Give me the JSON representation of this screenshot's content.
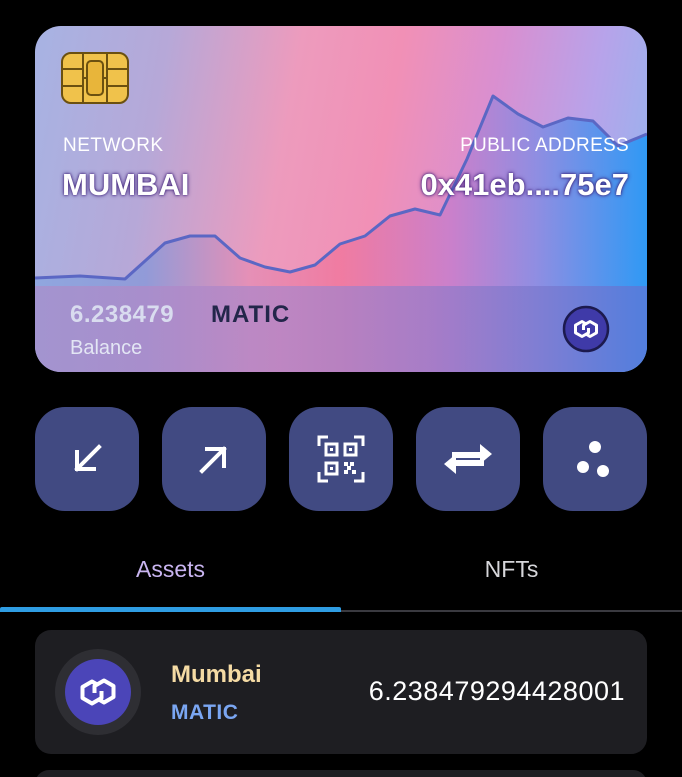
{
  "card": {
    "network_label": "NETWORK",
    "network_name": "MUMBAI",
    "address_label": "PUBLIC ADDRESS",
    "address_value": "0x41eb....75e7",
    "balance_amount": "6.238479",
    "balance_symbol": "MATIC",
    "balance_label": "Balance",
    "chip_icon": "sim-chip-icon",
    "token_icon": "polygon-logo-icon"
  },
  "actions": [
    {
      "name": "receive-button",
      "icon": "arrow-down-left-icon"
    },
    {
      "name": "send-button",
      "icon": "arrow-up-right-icon"
    },
    {
      "name": "scan-qr-button",
      "icon": "qr-code-icon"
    },
    {
      "name": "swap-button",
      "icon": "swap-arrows-icon"
    },
    {
      "name": "more-button",
      "icon": "three-dots-icon"
    }
  ],
  "tabs": [
    {
      "label": "Assets",
      "active": true
    },
    {
      "label": "NFTs",
      "active": false
    }
  ],
  "assets": [
    {
      "name": "Mumbai",
      "symbol": "MATIC",
      "balance": "6.238479294428001",
      "icon": "polygon-logo-icon"
    }
  ],
  "colors": {
    "background": "#000000",
    "action_button": "#414a82",
    "tab_indicator": "#2f9de3",
    "asset_row_bg": "#1e1e22",
    "asset_name": "#f5dba4",
    "asset_symbol": "#7aa6f2",
    "active_tab": "#c9b5f0"
  }
}
